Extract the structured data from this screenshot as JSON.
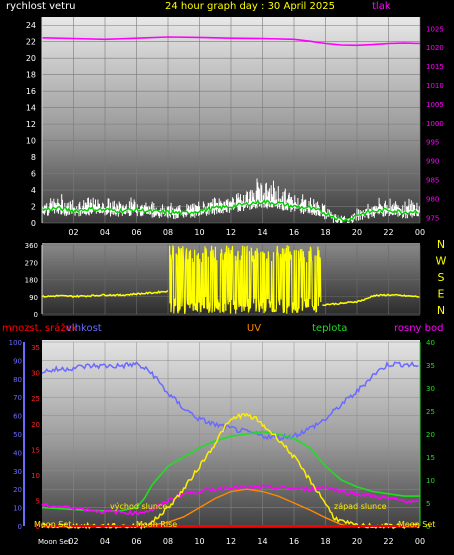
{
  "header": {
    "wind_label": "rychlost vetru",
    "title": "24 hour graph day : 30 April 2025",
    "pressure_label": "tlak"
  },
  "legend": {
    "rain": "mnozst. srážek",
    "humidity": "vlhkost",
    "uv": "UV",
    "temperature": "teplota",
    "dewpoint": "rosny bod"
  },
  "annotations": {
    "sunrise": "východ slunce",
    "sunset": "západ slunce",
    "moon_set_left": "Moon Set",
    "moon_rise": "Moon Rise",
    "moon_set_right": "Moon Set",
    "moon_set_bottom": "Moon Set"
  },
  "colors": {
    "wind": "#ffffff",
    "wind_avg": "#00cc00",
    "pressure": "#ff00ff",
    "direction": "#ffff00",
    "humidity": "#6a6aff",
    "temperature": "#22dd22",
    "dewpoint": "#ff00ff",
    "uv": "#ff8800",
    "solar": "#ffee00",
    "rain": "#ff0000",
    "title": "#ffff00"
  },
  "chart_data": [
    {
      "type": "line",
      "name": "wind-pressure",
      "x_ticks": [
        "02",
        "04",
        "06",
        "08",
        "10",
        "12",
        "14",
        "16",
        "18",
        "20",
        "22",
        "00"
      ],
      "y_left_ticks": [
        0,
        2,
        4,
        6,
        8,
        10,
        12,
        14,
        16,
        18,
        20,
        22,
        24
      ],
      "y_right_ticks": [
        975,
        980,
        985,
        990,
        995,
        1000,
        1005,
        1010,
        1015,
        1020,
        1025
      ],
      "ylim_left": [
        0,
        25
      ],
      "ylim_right": [
        973.5,
        1028
      ],
      "xlim": [
        0,
        24
      ],
      "series": [
        {
          "key": "pressure",
          "axis": "right",
          "x": [
            0,
            2,
            4,
            6,
            8,
            10,
            12,
            14,
            16,
            17,
            18,
            19,
            20,
            21,
            22,
            23,
            24
          ],
          "y": [
            1022.5,
            1022.3,
            1022.1,
            1022.4,
            1022.7,
            1022.6,
            1022.4,
            1022.3,
            1022.1,
            1021.6,
            1021.0,
            1020.6,
            1020.5,
            1020.7,
            1021.0,
            1021.1,
            1021.0
          ]
        },
        {
          "key": "wind_avg",
          "axis": "left",
          "x": [
            0,
            1,
            2,
            3,
            4,
            5,
            6,
            7,
            8,
            9,
            10,
            11,
            12,
            13,
            14,
            15,
            16,
            17,
            18,
            19,
            19.5,
            20,
            21,
            22,
            23,
            24
          ],
          "y": [
            1.6,
            1.8,
            1.5,
            1.7,
            1.6,
            1.5,
            1.6,
            1.4,
            1.3,
            1.2,
            1.5,
            1.8,
            2.0,
            2.3,
            2.6,
            2.4,
            2.0,
            1.8,
            1.2,
            0.4,
            0.4,
            1.0,
            1.4,
            1.6,
            1.3,
            1.5
          ]
        }
      ],
      "wind_gust_envelope": {
        "x": [
          0,
          1,
          2,
          3,
          4,
          5,
          6,
          7,
          8,
          9,
          10,
          11,
          12,
          13,
          14,
          15,
          16,
          17,
          18,
          19,
          19.5,
          20,
          21,
          22,
          23,
          24
        ],
        "y": [
          3.5,
          3.8,
          3.2,
          3.5,
          3.3,
          3.0,
          3.4,
          2.8,
          2.6,
          2.4,
          3.0,
          3.6,
          4.0,
          4.8,
          6.5,
          5.0,
          4.2,
          3.6,
          2.4,
          1.0,
          0.8,
          2.0,
          2.8,
          3.6,
          3.0,
          3.2
        ]
      }
    },
    {
      "type": "line",
      "name": "wind-direction",
      "y_ticks": [
        0,
        90,
        180,
        270,
        360
      ],
      "right_labels": [
        "N",
        "W",
        "S",
        "E",
        "N"
      ],
      "ylim": [
        0,
        360
      ],
      "xlim": [
        0,
        24
      ],
      "series": [
        {
          "key": "direction",
          "x": [
            0,
            1,
            2,
            3,
            4,
            5,
            6,
            7,
            7.5,
            8
          ],
          "y": [
            90,
            95,
            92,
            95,
            100,
            98,
            105,
            110,
            115,
            120
          ]
        },
        {
          "key": "direction",
          "x": [
            17.8,
            18,
            19,
            20,
            20.5,
            21,
            22,
            23,
            24
          ],
          "y": [
            45,
            50,
            55,
            65,
            75,
            95,
            100,
            95,
            90
          ]
        }
      ],
      "variable_band": {
        "x_start": 8.1,
        "x_end": 17.7,
        "ymin": 0,
        "ymax": 360
      }
    },
    {
      "type": "line",
      "name": "temperature-humidity",
      "y_hum_ticks": [
        0,
        10,
        20,
        30,
        40,
        50,
        60,
        70,
        80,
        90,
        100
      ],
      "y_rain_ticks": [
        0,
        5,
        10,
        15,
        20,
        25,
        30,
        35
      ],
      "y_temp_ticks": [
        0,
        5,
        10,
        15,
        20,
        25,
        30,
        35,
        40
      ],
      "xlim": [
        0,
        24
      ],
      "series": [
        {
          "key": "humidity",
          "scale": "hum",
          "x": [
            0,
            1,
            2,
            3,
            4,
            5,
            6,
            7,
            8,
            9,
            10,
            11,
            12,
            13,
            14,
            15,
            16,
            17,
            18,
            19,
            20,
            21,
            22,
            23,
            24
          ],
          "y": [
            84,
            85,
            86,
            87,
            87,
            87,
            88,
            83,
            72,
            64,
            58,
            55,
            53,
            51,
            49,
            48,
            49,
            53,
            58,
            66,
            73,
            82,
            88,
            88,
            87
          ]
        },
        {
          "key": "temperature",
          "scale": "temp",
          "x": [
            0,
            1,
            2,
            3,
            4,
            5,
            6,
            6.5,
            7,
            8,
            9,
            10,
            11,
            12,
            13,
            14,
            15,
            16,
            17,
            18,
            19,
            20,
            21,
            22,
            23,
            24
          ],
          "y": [
            4,
            3.8,
            3.6,
            3.4,
            3.3,
            3.3,
            4,
            6,
            9,
            13,
            15,
            17,
            18.5,
            19.5,
            20,
            20.5,
            20,
            19,
            17,
            13,
            10,
            8.5,
            7.5,
            7,
            6.5,
            6.5
          ]
        },
        {
          "key": "dewpoint",
          "scale": "temp",
          "x": [
            0,
            1,
            2,
            3,
            4,
            5,
            6,
            7,
            8,
            9,
            10,
            11,
            12,
            13,
            14,
            15,
            16,
            17,
            18,
            19,
            20,
            21,
            22,
            23,
            24
          ],
          "y": [
            4.5,
            4.2,
            4.0,
            3.5,
            3.1,
            3.0,
            2.8,
            3.5,
            5.5,
            7,
            7.5,
            8,
            8.5,
            8.2,
            8.5,
            8.3,
            8.2,
            8.0,
            8.5,
            7.5,
            7,
            6.5,
            6,
            5.5,
            5
          ]
        },
        {
          "key": "uv",
          "scale": "temp",
          "x": [
            0,
            6.5,
            7,
            8,
            9,
            10,
            11,
            12,
            13,
            14,
            15,
            16,
            17,
            18,
            19,
            19.5,
            24
          ],
          "y": [
            0,
            0,
            0.2,
            0.8,
            2.0,
            4.0,
            6.0,
            7.5,
            8.0,
            7.5,
            6.5,
            5.0,
            3.5,
            1.8,
            0.3,
            0,
            0
          ]
        },
        {
          "key": "solar",
          "scale": "temp",
          "x": [
            0,
            6.4,
            7,
            8,
            9,
            10,
            11,
            11.5,
            12,
            12.5,
            13,
            13.5,
            14,
            15,
            16,
            17,
            18,
            18.5,
            19,
            20,
            24
          ],
          "y": [
            0,
            0,
            0.8,
            4,
            8,
            13,
            18,
            21,
            23,
            24,
            24,
            23.5,
            22,
            19,
            15,
            10,
            5,
            2,
            1,
            0,
            0
          ]
        },
        {
          "key": "rain",
          "scale": "rain",
          "x": [
            0,
            24
          ],
          "y": [
            0,
            0
          ]
        }
      ]
    }
  ]
}
